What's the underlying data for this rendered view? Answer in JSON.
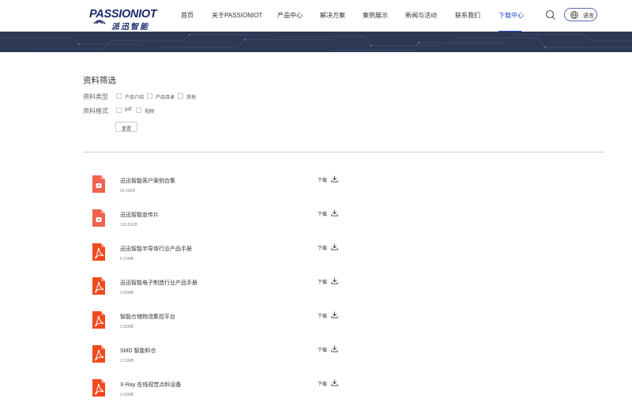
{
  "header": {
    "logo_text": "PASSIONIOT",
    "logo_text_cn": "派迅智能",
    "nav": [
      {
        "label": "首页"
      },
      {
        "label": "关于PASSIONIOT"
      },
      {
        "label": "产品中心"
      },
      {
        "label": "解决方案"
      },
      {
        "label": "案例展示"
      },
      {
        "label": "新闻与活动"
      },
      {
        "label": "联系我们"
      },
      {
        "label": "下载中心",
        "active": true
      }
    ],
    "search_icon": "search-icon",
    "language_label": "语言",
    "accent_color": "#2749c9"
  },
  "filter": {
    "title": "资料筛选",
    "type_label": "资料类型",
    "type_options": [
      "产品介绍",
      "产品目录",
      "其他"
    ],
    "format_label": "资料格式",
    "format_options": [
      "pdf",
      "视频"
    ],
    "reset_label": "重置"
  },
  "downloads": {
    "action_label": "下载",
    "items": [
      {
        "name": "迅迅智能客户案例合集",
        "size": "55.26KB",
        "icon": "video-file-icon"
      },
      {
        "name": "迅迅智能宣传片",
        "size": "133.51KB",
        "icon": "video-file-icon"
      },
      {
        "name": "迅迅智能半导体行业产品手册",
        "size": "6.23MB",
        "icon": "pdf-file-icon"
      },
      {
        "name": "迅迅智能电子制造行业产品手册",
        "size": "3.80MB",
        "icon": "pdf-file-icon"
      },
      {
        "name": "智能仓储物流集控平台",
        "size": "3.35MB",
        "icon": "pdf-file-icon"
      },
      {
        "name": "SMD 智能料仓",
        "size": "2.13MB",
        "icon": "pdf-file-icon"
      },
      {
        "name": "X-Ray 在线视觉点料设备",
        "size": "3.43MB",
        "icon": "pdf-file-icon"
      }
    ]
  }
}
